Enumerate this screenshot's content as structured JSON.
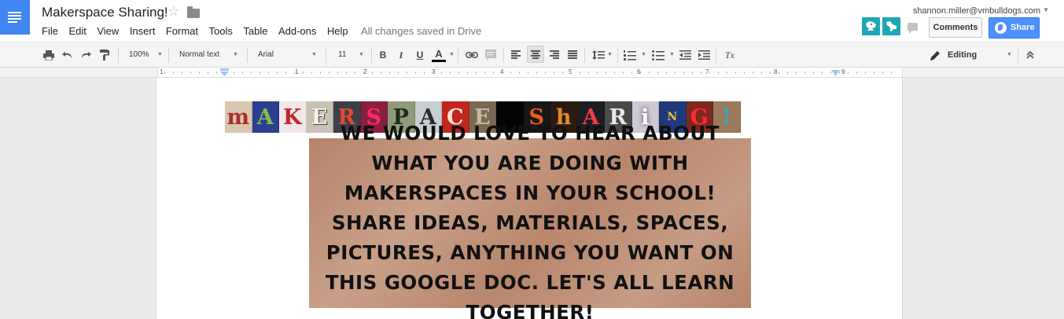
{
  "app": {
    "doc_title": "Makerspace Sharing!",
    "save_status": "All changes saved in Drive",
    "user_email": "shannon.miller@vmbulldogs.com"
  },
  "menu": [
    "File",
    "Edit",
    "View",
    "Insert",
    "Format",
    "Tools",
    "Table",
    "Add-ons",
    "Help"
  ],
  "buttons": {
    "comments": "Comments",
    "share": "Share"
  },
  "toolbar": {
    "zoom": "100%",
    "style": "Normal text",
    "font": "Arial",
    "size": "11",
    "bold": "B",
    "italic": "I",
    "underline": "U",
    "text_color": "A",
    "clear_format": "Tx",
    "mode": "Editing"
  },
  "ruler": {
    "numbers": [
      "1",
      "1",
      "2",
      "3",
      "4",
      "5",
      "6",
      "7",
      "8",
      "9"
    ]
  },
  "document": {
    "banner_letters": [
      "m",
      "A",
      "K",
      "E",
      "R",
      "S",
      "P",
      "A",
      "C",
      "E",
      " ",
      "S",
      "h",
      "A",
      "R",
      "i",
      "N",
      "G",
      "!"
    ],
    "body_text": "We would love to hear about what you are doing with makerspaces in your school! Share ideas, materials, spaces, pictures, anything you want on this Google Doc. Let's all learn together!"
  },
  "colors": {
    "brand_blue": "#4285f4",
    "share_blue": "#4d90fe",
    "avatar_teal": "#1da7b6"
  }
}
